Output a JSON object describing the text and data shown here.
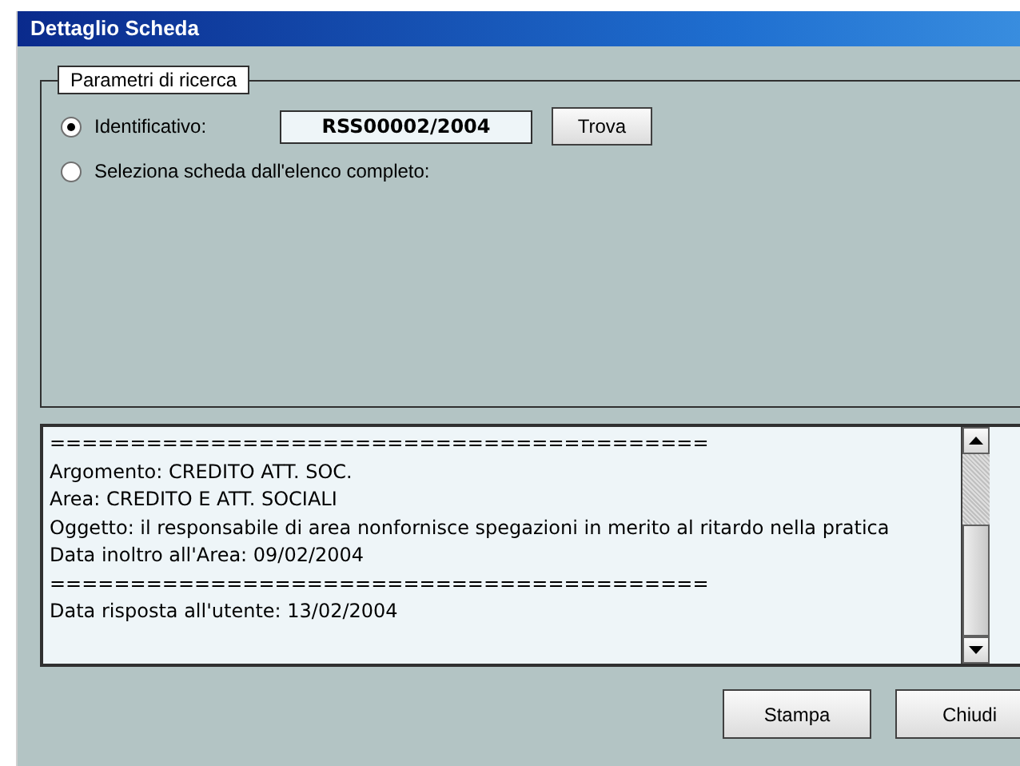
{
  "window": {
    "title": "Dettaglio Scheda"
  },
  "search_group": {
    "legend": "Parametri di ricerca",
    "options": [
      {
        "label": "Identificativo:",
        "selected": true,
        "kind": "id"
      },
      {
        "label": "Seleziona scheda dall'elenco completo:",
        "selected": false,
        "kind": "plain"
      }
    ],
    "id_field": {
      "value": "RSS00002/2004"
    },
    "find_button": "Trova"
  },
  "details": {
    "lines": [
      "=========================================",
      "Argomento: CREDITO ATT. SOC.",
      "Area: CREDITO E ATT. SOCIALI",
      "Oggetto: il responsabile di area nonfornisce spegazioni in merito al ritardo nella pratica",
      "Data inoltro all'Area: 09/02/2004",
      "=========================================",
      "Data risposta all'utente: 13/02/2004"
    ]
  },
  "buttons": [
    "Stampa",
    "Chiudi"
  ]
}
